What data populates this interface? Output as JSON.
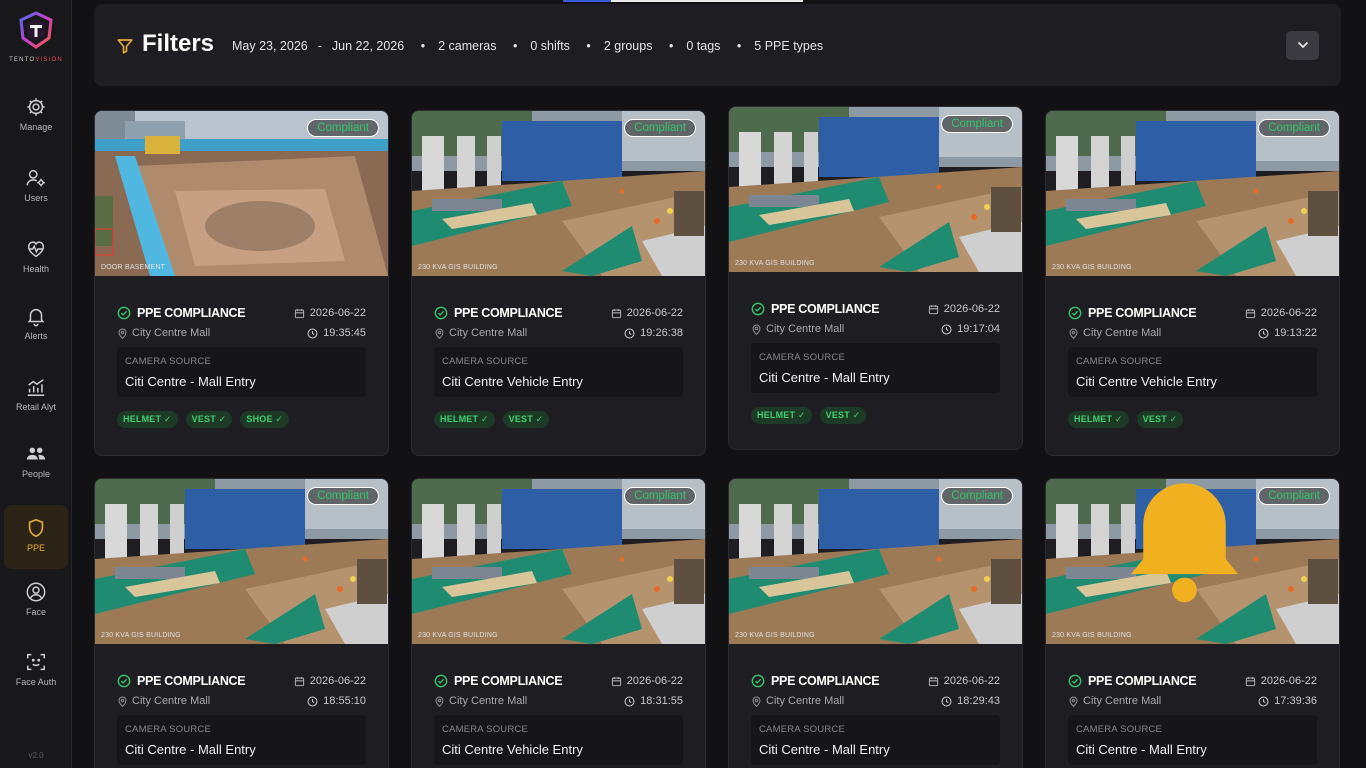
{
  "app": {
    "brand": "TENTO",
    "brand_accent": "VISION",
    "version": "v2.0"
  },
  "sidebar": {
    "items": [
      {
        "label": "Manage",
        "icon": "gear-icon"
      },
      {
        "label": "Users",
        "icon": "users-settings-icon"
      },
      {
        "label": "Health",
        "icon": "heart-pulse-icon"
      },
      {
        "label": "Alerts",
        "icon": "bell-icon"
      },
      {
        "label": "Retail Alyt",
        "icon": "analytics-icon"
      },
      {
        "label": "People",
        "icon": "people-icon"
      },
      {
        "label": "PPE",
        "icon": "shield-icon",
        "active": true
      },
      {
        "label": "Face",
        "icon": "face-icon"
      },
      {
        "label": "Face Auth",
        "icon": "face-scan-icon"
      }
    ]
  },
  "filters": {
    "title": "Filters",
    "date_start": "May 23, 2026",
    "date_sep": "-",
    "date_end": "Jun 22, 2026",
    "cameras": "2 cameras",
    "shifts": "0 shifts",
    "groups": "2 groups",
    "tags": "0 tags",
    "ppe_types": "5 PPE types"
  },
  "labels": {
    "badge": "Compliant",
    "status": "PPE COMPLIANCE",
    "source_caption": "CAMERA SOURCE",
    "site_overlay": "230 KVA GIS BUILDING",
    "site_overlay_first": "DOOR BASEMENT"
  },
  "cards": [
    {
      "date": "2026-06-22",
      "time": "19:35:45",
      "location": "City Centre Mall",
      "source": "Citi Centre - Mall Entry",
      "tags": [
        "HELMET ✓",
        "VEST ✓",
        "SHOE ✓"
      ]
    },
    {
      "date": "2026-06-22",
      "time": "19:26:38",
      "location": "City Centre Mall",
      "source": "Citi Centre Vehicle Entry",
      "tags": [
        "HELMET ✓",
        "VEST ✓"
      ]
    },
    {
      "date": "2026-06-22",
      "time": "19:17:04",
      "location": "City Centre Mall",
      "source": "Citi Centre - Mall Entry",
      "tags": [
        "HELMET ✓",
        "VEST ✓"
      ]
    },
    {
      "date": "2026-06-22",
      "time": "19:13:22",
      "location": "City Centre Mall",
      "source": "Citi Centre Vehicle Entry",
      "tags": [
        "HELMET ✓",
        "VEST ✓"
      ]
    },
    {
      "date": "2026-06-22",
      "time": "18:55:10",
      "location": "City Centre Mall",
      "source": "Citi Centre - Mall Entry",
      "tags": []
    },
    {
      "date": "2026-06-22",
      "time": "18:31:55",
      "location": "City Centre Mall",
      "source": "Citi Centre Vehicle Entry",
      "tags": []
    },
    {
      "date": "2026-06-22",
      "time": "18:29:43",
      "location": "City Centre Mall",
      "source": "Citi Centre - Mall Entry",
      "tags": []
    },
    {
      "date": "2026-06-22",
      "time": "17:39:36",
      "location": "City Centre Mall",
      "source": "Citi Centre - Mall Entry",
      "tags": []
    }
  ],
  "colors": {
    "accent": "#e7a93a",
    "compliant_green": "#35c46a",
    "card_bg": "#1e1e22",
    "page_bg": "#121214"
  }
}
